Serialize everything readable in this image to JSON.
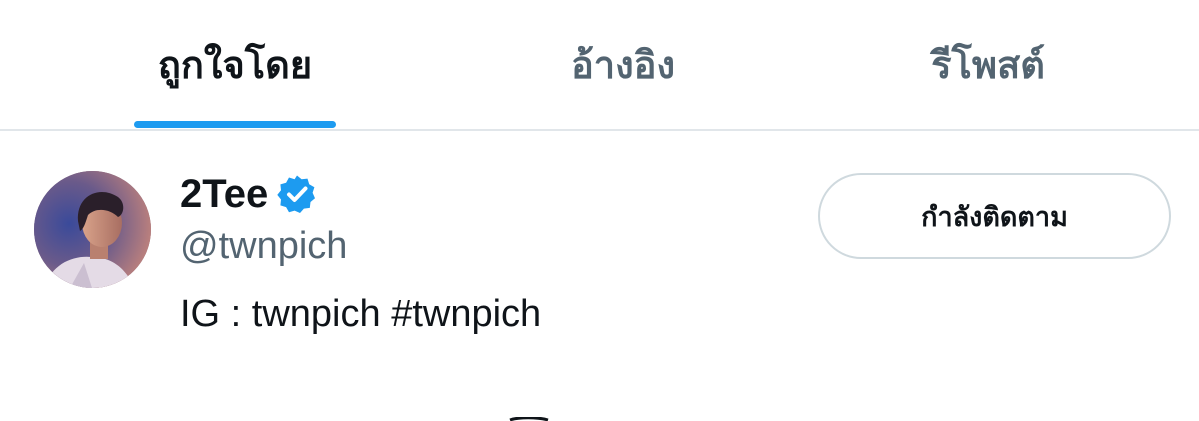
{
  "tabs": {
    "items": [
      {
        "label": "ถูกใจโดย",
        "active": true
      },
      {
        "label": "อ้างอิง",
        "active": false
      },
      {
        "label": "รีโพสต์",
        "active": false
      }
    ]
  },
  "user": {
    "display_name": "2Tee",
    "handle": "@twnpich",
    "bio": "IG : twnpich #twnpich",
    "verified": true,
    "avatar_icon": "profile-photo",
    "follow_button_label": "กำลังติดตาม"
  },
  "colors": {
    "accent": "#1d9bf0",
    "text_primary": "#0f1419",
    "text_secondary": "#536471",
    "border": "#cfd9de"
  }
}
